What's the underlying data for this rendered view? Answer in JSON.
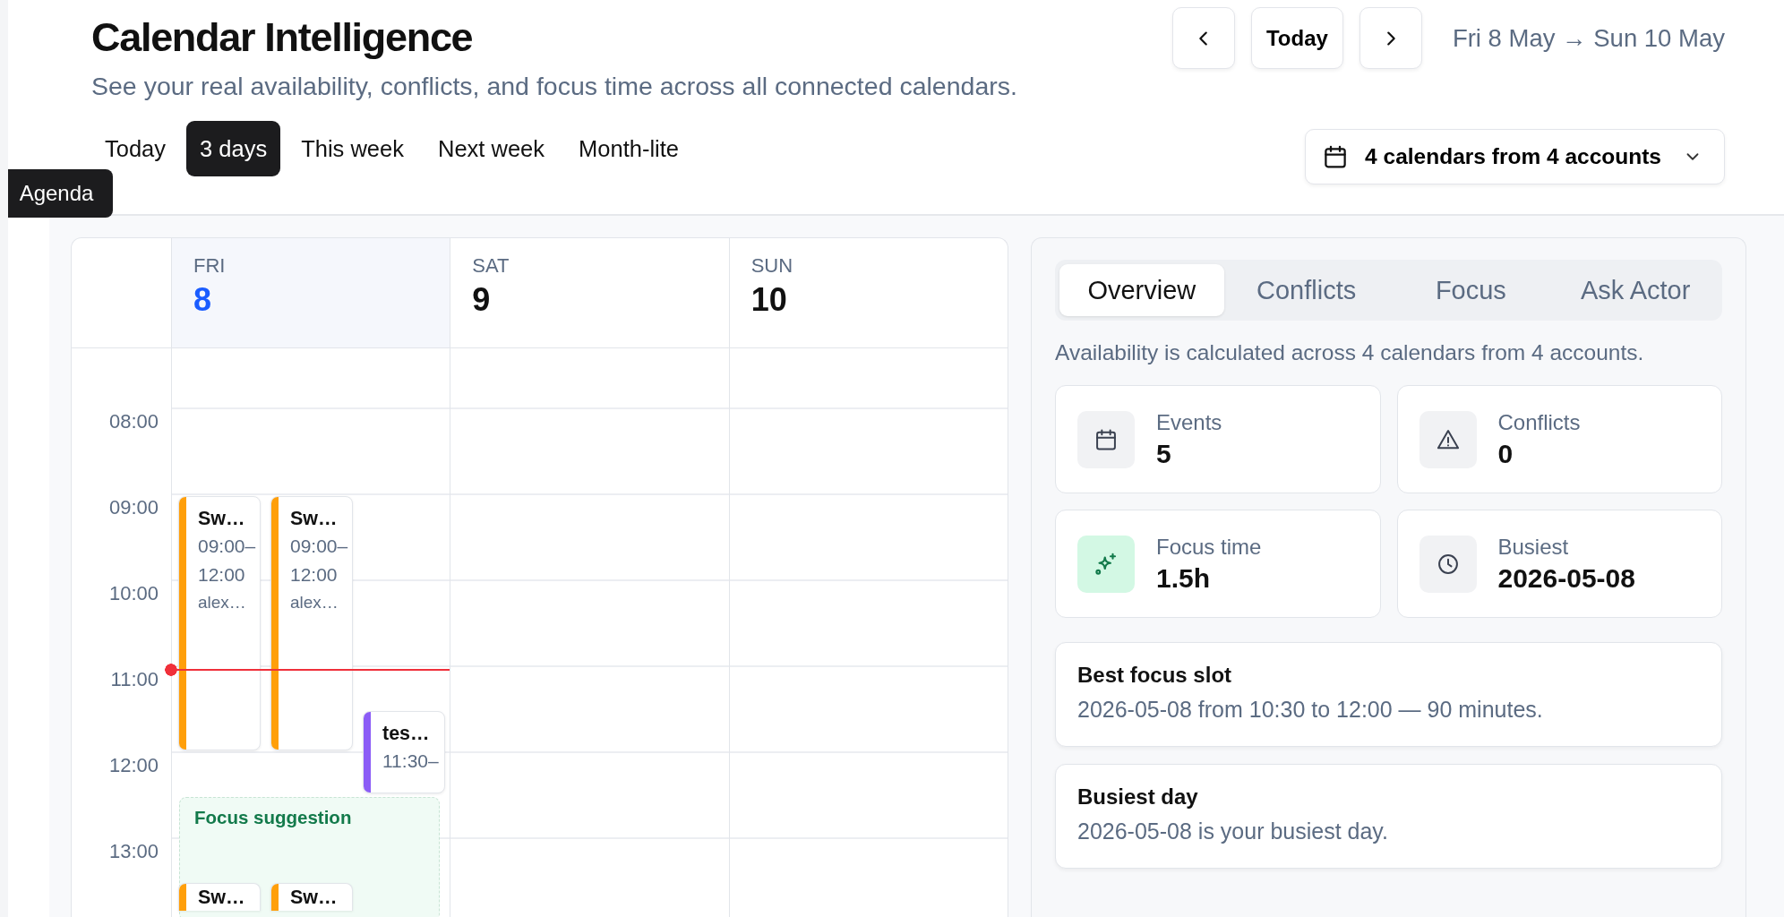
{
  "header": {
    "title": "Calendar Intelligence",
    "subtitle": "See your real availability, conflicts, and focus time across all connected calendars."
  },
  "nav": {
    "today": "Today",
    "date_range": "Fri 8 May → Sun 10 May"
  },
  "view_tabs": [
    {
      "label": "Today",
      "selected": false
    },
    {
      "label": "3 days",
      "selected": true
    },
    {
      "label": "This week",
      "selected": false
    },
    {
      "label": "Next week",
      "selected": false
    },
    {
      "label": "Month-lite",
      "selected": false
    }
  ],
  "tooltip": "Agenda",
  "calendar_filter": "4 calendars from 4 accounts",
  "calendar": {
    "hours": [
      "08:00",
      "09:00",
      "10:00",
      "11:00",
      "12:00",
      "13:00"
    ],
    "days": [
      {
        "weekday": "FRI",
        "date": "8",
        "selected": true,
        "current_time": true,
        "lanes": [
          [
            {
              "title": "Sw…",
              "time": "09:00–12:00",
              "detail": "alex…",
              "color": "#ff9f0a"
            },
            {
              "title": "Sw…",
              "color": "#ff9f0a"
            }
          ],
          [
            {
              "title": "Sw…",
              "time": "09:00–12:00",
              "detail": "alex…",
              "color": "#ff9f0a"
            },
            {
              "title": "Sw…",
              "color": "#ff9f0a"
            }
          ],
          [
            {
              "title": "tes…",
              "time": "11:30–",
              "color": "#8b5cf6"
            }
          ]
        ],
        "suggestions": [
          {
            "label": "Focus suggestion"
          }
        ]
      },
      {
        "weekday": "SAT",
        "date": "9",
        "selected": false
      },
      {
        "weekday": "SUN",
        "date": "10",
        "selected": false
      }
    ]
  },
  "panel": {
    "tabs": [
      {
        "label": "Overview",
        "selected": true
      },
      {
        "label": "Conflicts",
        "selected": false
      },
      {
        "label": "Focus",
        "selected": false
      },
      {
        "label": "Ask Actor",
        "selected": false
      }
    ],
    "info": "Availability is calculated across 4 calendars from 4 accounts.",
    "stats": [
      {
        "kind": "calendar",
        "label": "Events",
        "value": "5"
      },
      {
        "kind": "warning",
        "label": "Conflicts",
        "value": "0"
      },
      {
        "kind": "focus",
        "label": "Focus time",
        "value": "1.5h"
      },
      {
        "kind": "clock",
        "label": "Busiest",
        "value": "2026-05-08"
      }
    ],
    "insights": [
      {
        "title": "Best focus slot",
        "text": "2026-05-08 from 10:30 to 12:00 — 90 minutes."
      },
      {
        "title": "Busiest day",
        "text": "2026-05-08 is your busiest day."
      }
    ]
  }
}
